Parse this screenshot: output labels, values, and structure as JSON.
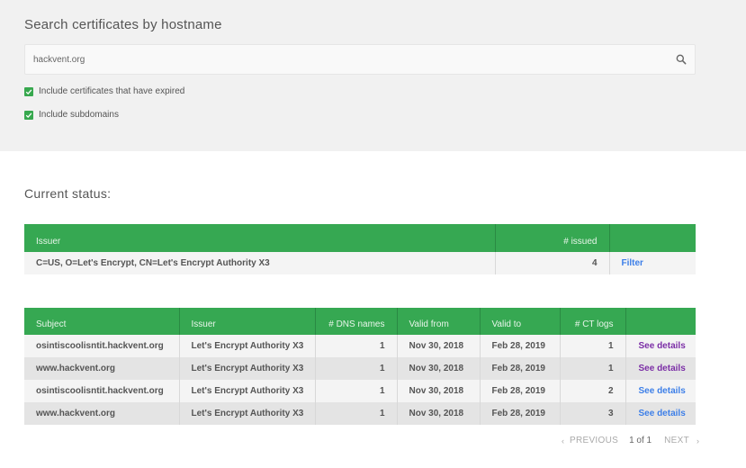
{
  "search": {
    "title": "Search certificates by hostname",
    "value": "hackvent.org",
    "placeholder": "",
    "options": [
      {
        "label": "Include certificates that have expired",
        "checked": true
      },
      {
        "label": "Include subdomains",
        "checked": true
      }
    ]
  },
  "status": {
    "title": "Current status:"
  },
  "issuer_table": {
    "headers": [
      "Issuer",
      "# issued",
      ""
    ],
    "rows": [
      {
        "issuer": "C=US, O=Let's Encrypt, CN=Let's Encrypt Authority X3",
        "issued": "4",
        "action": "Filter"
      }
    ]
  },
  "cert_table": {
    "headers": [
      "Subject",
      "Issuer",
      "# DNS names",
      "Valid from",
      "Valid to",
      "# CT logs",
      ""
    ],
    "rows": [
      {
        "subject": "osintiscoolisntit.hackvent.org",
        "issuer": "Let's Encrypt Authority X3",
        "dns": "1",
        "from": "Nov 30, 2018",
        "to": "Feb 28, 2019",
        "ct": "1",
        "action": "See details",
        "visited": true
      },
      {
        "subject": "www.hackvent.org",
        "issuer": "Let's Encrypt Authority X3",
        "dns": "1",
        "from": "Nov 30, 2018",
        "to": "Feb 28, 2019",
        "ct": "1",
        "action": "See details",
        "visited": true
      },
      {
        "subject": "osintiscoolisntit.hackvent.org",
        "issuer": "Let's Encrypt Authority X3",
        "dns": "1",
        "from": "Nov 30, 2018",
        "to": "Feb 28, 2019",
        "ct": "2",
        "action": "See details",
        "visited": false
      },
      {
        "subject": "www.hackvent.org",
        "issuer": "Let's Encrypt Authority X3",
        "dns": "1",
        "from": "Nov 30, 2018",
        "to": "Feb 28, 2019",
        "ct": "3",
        "action": "See details",
        "visited": false
      }
    ]
  },
  "pager": {
    "prev": "PREVIOUS",
    "page": "1 of 1",
    "next": "NEXT"
  },
  "colors": {
    "accent_green": "#36a852",
    "link_blue": "#3d7fe8",
    "link_visited": "#7b2ea6"
  },
  "icons": {
    "search": "search-icon",
    "check": "check-icon",
    "prev": "chevron-left-icon",
    "next": "chevron-right-icon"
  }
}
